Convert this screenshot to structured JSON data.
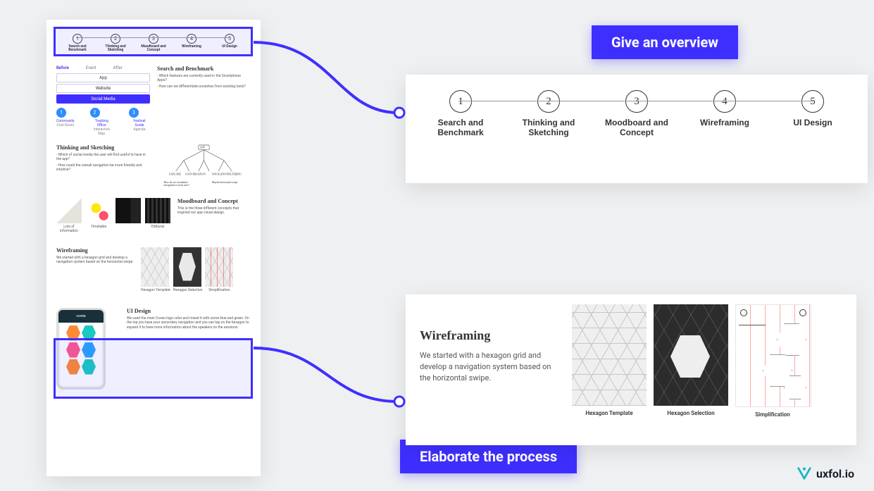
{
  "badges": {
    "overview": "Give an overview",
    "process": "Elaborate the process"
  },
  "overview_steps": [
    {
      "num": "1",
      "label": "Search and Benchmark"
    },
    {
      "num": "2",
      "label": "Thinking and Sketching"
    },
    {
      "num": "3",
      "label": "Moodboard and Concept"
    },
    {
      "num": "4",
      "label": "Wireframing"
    },
    {
      "num": "5",
      "label": "UI Design"
    }
  ],
  "wire": {
    "heading": "Wireframing",
    "body": "We started with a hexagon grid and develop a navigation system based on the horizontal swipe.",
    "caps": [
      "Hexagon Template",
      "Hexagon Selection",
      "Simplification"
    ]
  },
  "mock": {
    "search": {
      "heading": "Search and Benchmark",
      "q1": "- Which features are currently used in the Smartphone Apps?",
      "q2": "- How can we differentiate ourselves from existing tools?",
      "tabs": [
        "Before",
        "Event",
        "After"
      ],
      "pills": [
        "App",
        "Website",
        "Social Media"
      ],
      "dot_labels_top": [
        "Community",
        "Tracking Office",
        "Festival Guide"
      ],
      "dot_labels_bot": [
        "Chat Room",
        "Interactive Map",
        "Agenda"
      ]
    },
    "thinking": {
      "heading": "Thinking and Sketching",
      "q1": "- Which of social media the user will find useful to have in the app?",
      "q2": "- How could the overall navigation be more friendly and intuitive?"
    },
    "mood": {
      "heading": "Moodboard and Concept",
      "body": "This is the three different concepts that inspired our app visual design.",
      "caps": [
        "Lots of information",
        "Timetable",
        "Editorial"
      ]
    },
    "wire": {
      "heading": "Wireframing",
      "body": "We started with a hexagon grid and develop a navigation system based on the horizontal swipe.",
      "caps": [
        "Hexagon Template",
        "Hexagon Selection",
        "Simplification"
      ]
    },
    "ui": {
      "heading": "UI Design",
      "body": "We used the main Coveo logo color and mixed it with some blue and green. On the top you have your secondary navigation and you can tap on the hexagon to expand it to have more information about the speakers on the sessions.",
      "phone_title": "covéa"
    }
  },
  "brand": "uxfol.io"
}
